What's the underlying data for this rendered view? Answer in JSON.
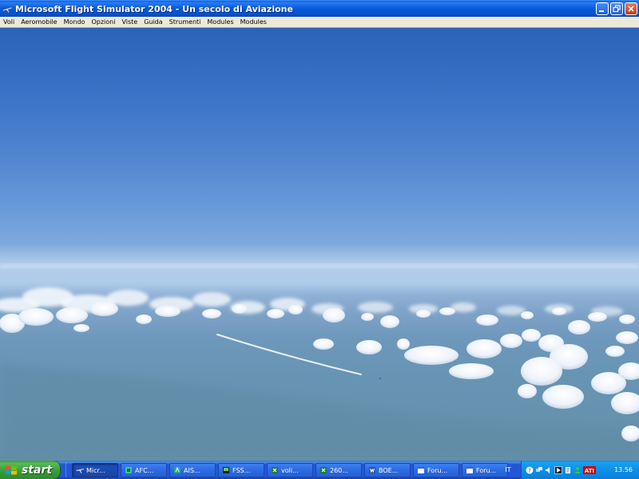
{
  "window": {
    "title": "Microsoft Flight Simulator 2004 - Un secolo di Aviazione",
    "icon": "airplane-icon",
    "controls": [
      "minimize-icon",
      "restore-icon",
      "close-icon"
    ]
  },
  "menubar": {
    "items": [
      "Voli",
      "Aeromobile",
      "Mondo",
      "Opzioni",
      "Viste",
      "Guida",
      "Strumenti",
      "Modules",
      "Modules"
    ]
  },
  "taskbar": {
    "start_label": "start",
    "tasks": [
      {
        "label": "Micr...",
        "icon": "airplane-icon",
        "active": true
      },
      {
        "label": "AFC...",
        "icon": "app-icon",
        "active": false
      },
      {
        "label": "AIS...",
        "icon": "app-icon",
        "active": false
      },
      {
        "label": "FSS...",
        "icon": "app-icon",
        "active": false
      },
      {
        "label": "voli...",
        "icon": "excel-icon",
        "active": false
      },
      {
        "label": "260...",
        "icon": "excel-icon",
        "active": false
      },
      {
        "label": "BOE...",
        "icon": "word-icon",
        "active": false
      },
      {
        "label": "Foru...",
        "icon": "browser-icon",
        "active": false
      },
      {
        "label": "Foru...",
        "icon": "browser-icon",
        "active": false
      }
    ],
    "language": "IT",
    "tray_badge": "ATI",
    "clock": "13.56"
  },
  "colors": {
    "title_blue": "#0758d6",
    "taskbar_blue": "#2157d7",
    "start_green": "#3a9d3a",
    "sky_top": "#2b63b9",
    "sea": "#6590aa"
  }
}
